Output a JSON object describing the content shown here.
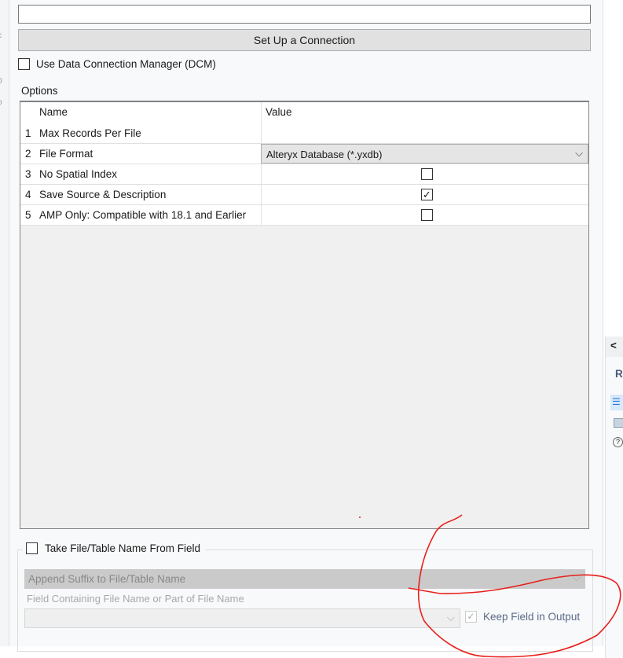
{
  "connection": {
    "input_value": "",
    "setup_button": "Set Up a Connection",
    "dcm_label": "Use Data Connection Manager (DCM)",
    "dcm_checked": false
  },
  "options": {
    "label": "Options",
    "headers": {
      "name": "Name",
      "value": "Value"
    },
    "rows": [
      {
        "num": "1",
        "name": "Max Records Per File",
        "value": ""
      },
      {
        "num": "2",
        "name": "File Format",
        "value": "Alteryx Database (*.yxdb)"
      },
      {
        "num": "3",
        "name": "No Spatial Index",
        "checked": false
      },
      {
        "num": "4",
        "name": "Save Source & Description",
        "checked": true
      },
      {
        "num": "5",
        "name": "AMP Only: Compatible with 18.1 and Earlier",
        "checked": false
      }
    ]
  },
  "take_name": {
    "label": "Take File/Table Name From Field",
    "checked": false,
    "mode_value": "Append Suffix to File/Table Name",
    "field_label": "Field Containing File Name or Part of File Name",
    "field_value": "",
    "keep_label": "Keep Field in Output",
    "keep_checked": true
  },
  "right_panel": {
    "collapse": "<",
    "tab_letter": "R"
  },
  "annotation_color": "#e8201a"
}
